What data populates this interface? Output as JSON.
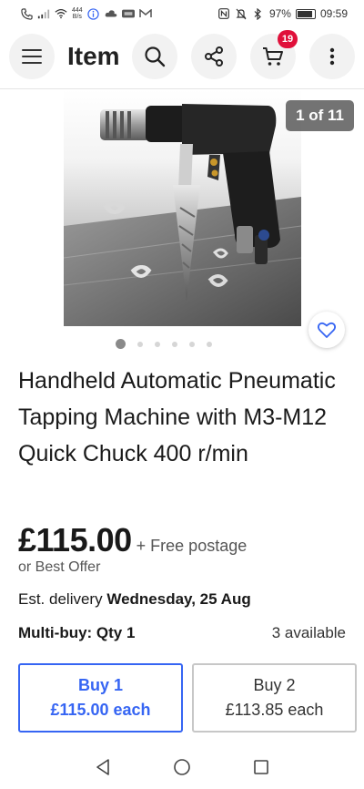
{
  "status_bar": {
    "net_speed_value": "444",
    "net_speed_unit": "B/s",
    "battery_percent": "97%",
    "battery_level": 0.97,
    "time": "09:59",
    "icons": [
      "phone-icon",
      "signal-icon",
      "wifi-icon",
      "info-icon",
      "cloud-icon",
      "app-icon",
      "mail-icon",
      "nfc-icon",
      "silent-icon",
      "bluetooth-icon",
      "battery-icon"
    ]
  },
  "header": {
    "title": "Item",
    "cart_count": "19"
  },
  "gallery": {
    "counter": "1 of 11",
    "total_images": 11,
    "current_index": 1
  },
  "item": {
    "title": "Handheld Automatic Pneumatic Tapping Machine with M3-M12 Quick Chuck 400 r/min",
    "price": "£115.00",
    "postage": "+ Free postage",
    "best_offer": "or Best Offer",
    "delivery_prefix": "Est. delivery",
    "delivery_date": "Wednesday, 25 Aug",
    "multibuy_label": "Multi-buy: Qty 1",
    "available": "3 available"
  },
  "buy_options": [
    {
      "qty_label": "Buy 1",
      "price_label": "£115.00 each",
      "selected": true
    },
    {
      "qty_label": "Buy 2",
      "price_label": "£113.85 each",
      "selected": false
    }
  ],
  "colors": {
    "accent": "#3665f3",
    "badge": "#e0103a",
    "text": "#191919"
  }
}
